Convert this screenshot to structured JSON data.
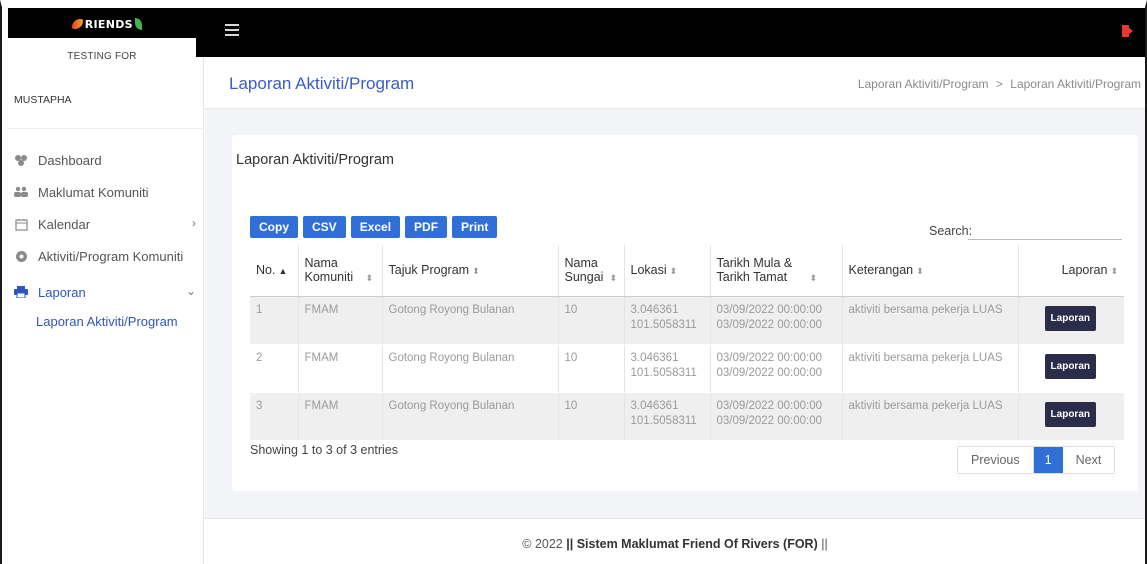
{
  "brand": {
    "logo_text": "RIENDS",
    "subtitle": "TESTING FOR"
  },
  "user": {
    "name": "MUSTAPHA"
  },
  "sidebar": {
    "items": [
      {
        "label": "Dashboard",
        "icon": "dashboard-icon"
      },
      {
        "label": "Maklumat Komuniti",
        "icon": "users-icon"
      },
      {
        "label": "Kalendar",
        "icon": "calendar-icon"
      },
      {
        "label": "Aktiviti/Program Komuniti",
        "icon": "activity-icon"
      },
      {
        "label": "Laporan",
        "icon": "print-icon"
      }
    ],
    "sub_item": "Laporan Aktiviti/Program"
  },
  "header": {
    "title": "Laporan Aktiviti/Program",
    "breadcrumb": [
      "Laporan Aktiviti/Program",
      ">",
      "Laporan Aktiviti/Program"
    ]
  },
  "card": {
    "title": "Laporan Aktiviti/Program",
    "buttons": [
      "Copy",
      "CSV",
      "Excel",
      "PDF",
      "Print"
    ],
    "search_label": "Search:",
    "search_value": ""
  },
  "table": {
    "columns": [
      "No.",
      "Nama Komuniti",
      "Tajuk Program",
      "Nama Sungai",
      "Lokasi",
      "Tarikh Mula & Tarikh Tamat",
      "Keterangan",
      "Laporan"
    ],
    "rows": [
      {
        "no": "1",
        "komuniti": "FMAM",
        "tajuk": "Gotong Royong Bulanan",
        "sungai": "10",
        "lokasi1": "3.046361",
        "lokasi2": "101.5058311",
        "mula": "03/09/2022 00:00:00",
        "tamat": "03/09/2022 00:00:00",
        "keterangan": "aktiviti bersama pekerja LUAS",
        "laporan": "Laporan"
      },
      {
        "no": "2",
        "komuniti": "FMAM",
        "tajuk": "Gotong Royong Bulanan",
        "sungai": "10",
        "lokasi1": "3.046361",
        "lokasi2": "101.5058311",
        "mula": "03/09/2022 00:00:00",
        "tamat": "03/09/2022 00:00:00",
        "keterangan": "aktiviti bersama pekerja LUAS",
        "laporan": "Laporan"
      },
      {
        "no": "3",
        "komuniti": "FMAM",
        "tajuk": "Gotong Royong Bulanan",
        "sungai": "10",
        "lokasi1": "3.046361",
        "lokasi2": "101.5058311",
        "mula": "03/09/2022 00:00:00",
        "tamat": "03/09/2022 00:00:00",
        "keterangan": "aktiviti bersama pekerja LUAS",
        "laporan": "Laporan"
      }
    ]
  },
  "pagination": {
    "showing": "Showing 1 to 3 of 3 entries",
    "previous": "Previous",
    "current": "1",
    "next": "Next"
  },
  "footer": {
    "prefix": "© 2022 ",
    "sep1": "||",
    "name": "Sistem Maklumat Friend Of Rivers (FOR)",
    "sep2": "||"
  },
  "colors": {
    "topbar": "#000000",
    "accent": "#2f6fd6",
    "title": "#3b5bc7",
    "laporan_button": "#2a2c4a",
    "logout": "#e53935"
  }
}
